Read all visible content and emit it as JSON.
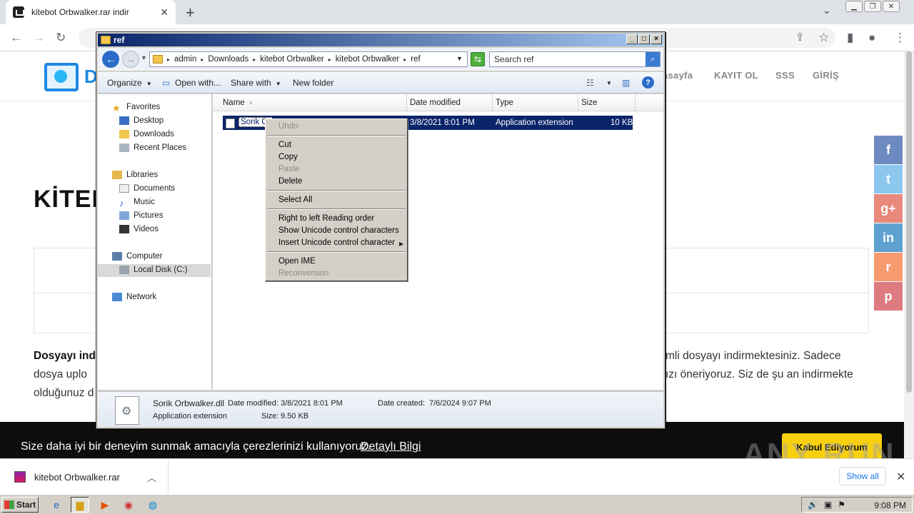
{
  "browser": {
    "tab_title": "kitebot Orbwalker.rar indir",
    "new_tab": "+",
    "tab_close": "✕"
  },
  "site": {
    "nav": [
      "asayfa",
      "KAYIT OL",
      "SSS",
      "GİRİŞ"
    ],
    "heading": "KİTEI",
    "para_left_1_bold": "Dosyayı ind",
    "para_left_2": "dosya uplo",
    "para_left_3": "olduğunuz d",
    "para_right_1": "mli dosyayı indirmektesiniz. Sadece",
    "para_right_2": "ızı öneriyoruz. Siz de şu an indirmekte",
    "social": [
      {
        "icon": "facebook-icon",
        "glyph": "f",
        "color": "#3b5998"
      },
      {
        "icon": "twitter-icon",
        "glyph": "t",
        "color": "#55acee"
      },
      {
        "icon": "google-plus-icon",
        "glyph": "g+",
        "color": "#dd4b39"
      },
      {
        "icon": "linkedin-icon",
        "glyph": "in",
        "color": "#0077b5"
      },
      {
        "icon": "reddit-icon",
        "glyph": "r",
        "color": "#ff4500"
      },
      {
        "icon": "pinterest-icon",
        "glyph": "p",
        "color": "#cb2027"
      }
    ],
    "cookie_text": "Size daha iyi bir deneyim sunmak amacıyla çerezlerinizi kullanıyoruz.",
    "cookie_link": "Detaylı Bilgi",
    "cookie_button": "Kabul Ediyorum"
  },
  "watermark": "ANY RUN",
  "download_bar": {
    "file_name": "kitebot Orbwalker.rar",
    "show_all": "Show all"
  },
  "taskbar": {
    "start": "Start",
    "clock": "9:08 PM"
  },
  "explorer": {
    "title": "ref",
    "breadcrumbs": [
      "admin",
      "Downloads",
      "kitebot Orbwalker",
      "kitebot Orbwalker",
      "ref"
    ],
    "search_placeholder": "Search ref",
    "commands": {
      "organize": "Organize",
      "open_with": "Open with...",
      "share_with": "Share with",
      "new_folder": "New folder"
    },
    "nav_pane": {
      "favorites": "Favorites",
      "desktop": "Desktop",
      "downloads": "Downloads",
      "recent_places": "Recent Places",
      "libraries": "Libraries",
      "documents": "Documents",
      "music": "Music",
      "pictures": "Pictures",
      "videos": "Videos",
      "computer": "Computer",
      "local_disk": "Local Disk (C:)",
      "network": "Network"
    },
    "columns": {
      "name": "Name",
      "date_modified": "Date modified",
      "type": "Type",
      "size": "Size"
    },
    "file": {
      "name_editing": "Sorik Or",
      "date_modified": "3/8/2021 8:01 PM",
      "type": "Application extension",
      "size": "10 KB"
    },
    "details": {
      "file_name": "Sorik Orbwalker.dll",
      "date_modified_label": "Date modified:",
      "date_modified": "3/8/2021 8:01 PM",
      "date_created_label": "Date created:",
      "date_created": "7/6/2024 9:07 PM",
      "type": "Application extension",
      "size_label": "Size:",
      "size": "9.50 KB"
    }
  },
  "context_menu": {
    "undo": "Undo",
    "cut": "Cut",
    "copy": "Copy",
    "paste": "Paste",
    "delete": "Delete",
    "select_all": "Select All",
    "rtl": "Right to left Reading order",
    "show_unicode": "Show Unicode control characters",
    "insert_unicode": "Insert Unicode control character",
    "open_ime": "Open IME",
    "reconversion": "Reconversion"
  }
}
